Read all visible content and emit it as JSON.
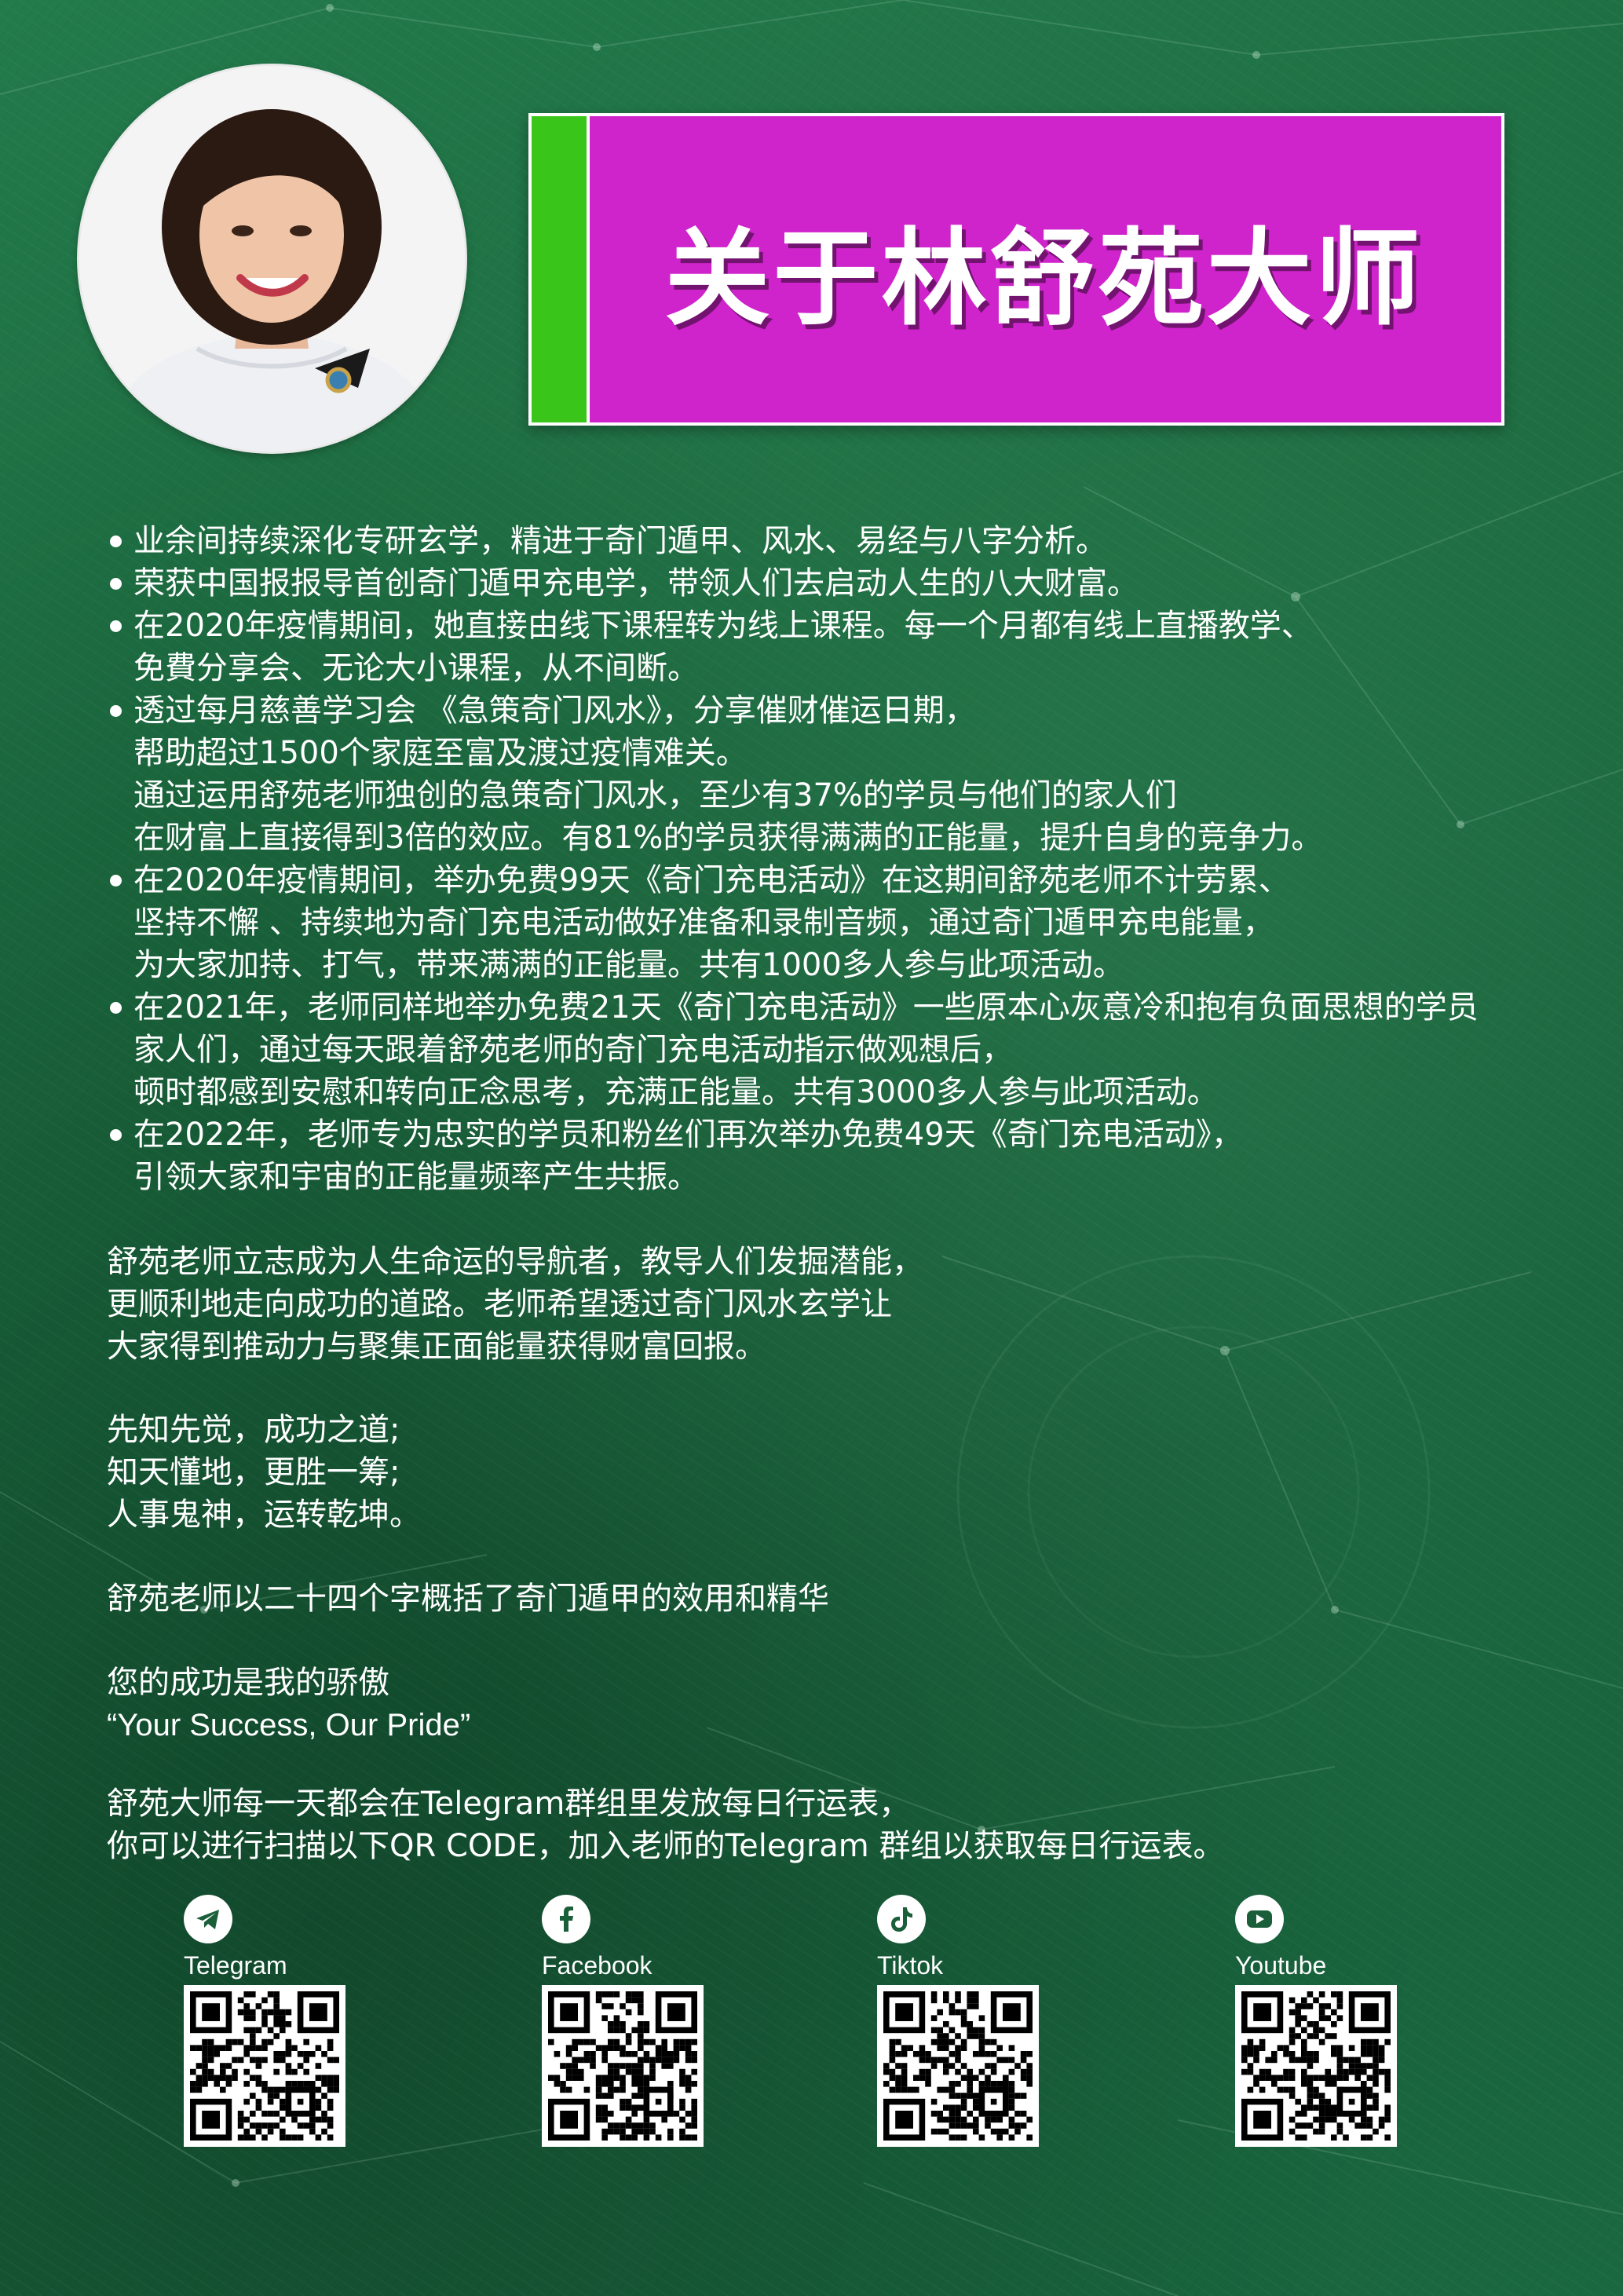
{
  "header": {
    "title": "关于林舒苑大师",
    "portrait_alt": "林舒苑大师 portrait",
    "colors": {
      "banner": "#cf23cc",
      "accent": "#3ac51b",
      "background": "#1b6a3f"
    }
  },
  "bullets": [
    {
      "lines": [
        "业余间持续深化专研玄学，精进于奇门遁甲、风水、易经与八字分析。"
      ]
    },
    {
      "lines": [
        "荣获中国报报导首创奇门遁甲充电学，带领人们去启动人生的八大财富。"
      ]
    },
    {
      "lines": [
        "在2020年疫情期间，她直接由线下课程转为线上课程。每一个月都有线上直播教学、",
        "免費分享会、无论大小课程，从不间断。"
      ]
    },
    {
      "lines": [
        "透过每月慈善学习会 《急策奇门风水》，分享催财催运日期，",
        "帮助超过1500个家庭至富及渡过疫情难关。",
        "通过运用舒苑老师独创的急策奇门风水，至少有37%的学员与他们的家人们",
        "在财富上直接得到3倍的效应。有81%的学员获得满满的正能量，提升自身的竞争力。"
      ]
    },
    {
      "lines": [
        "在2020年疫情期间，举办免费99天《奇门充电活动》在这期间舒苑老师不计劳累、",
        "坚持不懈 、持续地为奇门充电活动做好准备和录制音频，通过奇门遁甲充电能量，",
        "为大家加持、打气，带来满满的正能量。共有1000多人参与此项活动。"
      ]
    },
    {
      "lines": [
        "在2021年，老师同样地举办免费21天《奇门充电活动》一些原本心灰意冷和抱有负面思想的学员",
        "家人们，通过每天跟着舒苑老师的奇门充电活动指示做观想后，",
        "顿时都感到安慰和转向正念思考，充满正能量。共有3000多人参与此项活动。"
      ]
    },
    {
      "lines": [
        "在2022年，老师专为忠实的学员和粉丝们再次举办免费49天《奇门充电活动》，",
        "引领大家和宇宙的正能量频率产生共振。"
      ]
    }
  ],
  "mission": {
    "lines": [
      "舒苑老师立志成为人生命运的导航者，教导人们发掘潜能，",
      "更顺利地走向成功的道路。老师希望透过奇门风水玄学让",
      "大家得到推动力与聚集正面能量获得财富回报。"
    ]
  },
  "motto": {
    "lines": [
      "先知先觉，成功之道;",
      "知天懂地，更胜一筹;",
      "人事鬼神，运转乾坤。"
    ]
  },
  "summary": {
    "text": "舒苑老师以二十四个字概括了奇门遁甲的效用和精华"
  },
  "pride": {
    "lines": [
      "您的成功是我的骄傲",
      "“Your Success, Our Pride”"
    ]
  },
  "telegram_note": {
    "lines": [
      "舒苑大师每一天都会在Telegram群组里发放每日行运表，",
      "你可以进行扫描以下QR CODE，加入老师的Telegram 群组以获取每日行运表。"
    ]
  },
  "socials": [
    {
      "label": "Telegram",
      "icon": "telegram-icon"
    },
    {
      "label": "Facebook",
      "icon": "facebook-icon"
    },
    {
      "label": "Tiktok",
      "icon": "tiktok-icon"
    },
    {
      "label": "Youtube",
      "icon": "youtube-icon"
    }
  ]
}
